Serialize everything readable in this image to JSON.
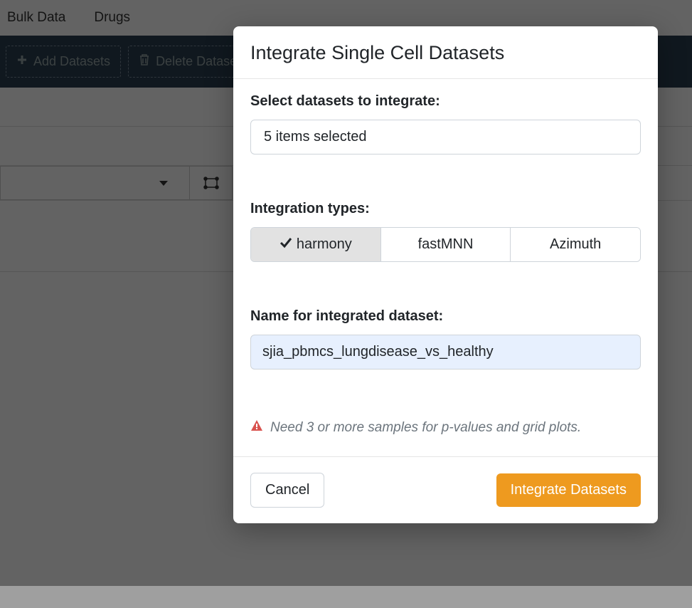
{
  "nav": {
    "bulk_data": "Bulk Data",
    "drugs": "Drugs"
  },
  "toolbar": {
    "add_datasets": "Add Datasets",
    "delete_datasets": "Delete Datasets"
  },
  "modal": {
    "title": "Integrate Single Cell Datasets",
    "select_label": "Select datasets to integrate:",
    "select_value": "5 items selected",
    "integration_label": "Integration types:",
    "integration_options": {
      "harmony": "harmony",
      "fastmnn": "fastMNN",
      "azimuth": "Azimuth"
    },
    "name_label": "Name for integrated dataset:",
    "name_value": "sjia_pbmcs_lungdisease_vs_healthy",
    "warning": "Need 3 or more samples for p-values and grid plots.",
    "cancel": "Cancel",
    "submit": "Integrate Datasets"
  }
}
